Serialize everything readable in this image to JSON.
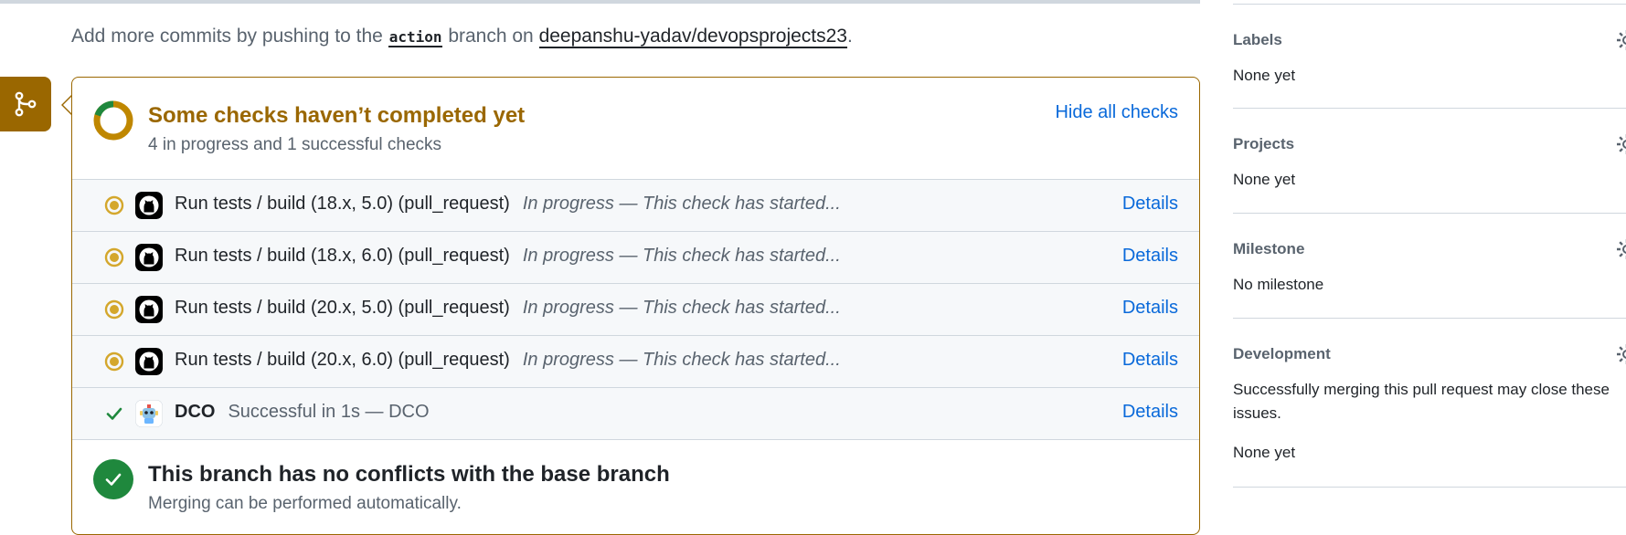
{
  "intro": {
    "prefix": "Add more commits by pushing to the",
    "branch": "action",
    "middle": "branch on",
    "repo": "deepanshu-yadav/devopsprojects23",
    "suffix": "."
  },
  "checks_panel": {
    "title": "Some checks haven’t completed yet",
    "summary": "4 in progress and 1 successful checks",
    "hide_label": "Hide all checks"
  },
  "checks": [
    {
      "name": "Run tests / build (18.x, 5.0) (pull_request)",
      "description": "In progress — This check has started...",
      "details": "Details",
      "status": "in-progress",
      "app_icon": "github-icon"
    },
    {
      "name": "Run tests / build (18.x, 6.0) (pull_request)",
      "description": "In progress — This check has started...",
      "details": "Details",
      "status": "in-progress",
      "app_icon": "github-icon"
    },
    {
      "name": "Run tests / build (20.x, 5.0) (pull_request)",
      "description": "In progress — This check has started...",
      "details": "Details",
      "status": "in-progress",
      "app_icon": "github-icon"
    },
    {
      "name": "Run tests / build (20.x, 6.0) (pull_request)",
      "description": "In progress — This check has started...",
      "details": "Details",
      "status": "in-progress",
      "app_icon": "github-icon"
    },
    {
      "name": "DCO",
      "description": "Successful in 1s — DCO",
      "details": "Details",
      "status": "success",
      "app_icon": "dco-bot-icon"
    }
  ],
  "merge_status": {
    "title": "This branch has no conflicts with the base branch",
    "subtitle": "Merging can be performed automatically."
  },
  "sidebar": {
    "labels": {
      "title": "Labels",
      "value": "None yet"
    },
    "projects": {
      "title": "Projects",
      "value": "None yet"
    },
    "milestone": {
      "title": "Milestone",
      "value": "No milestone"
    },
    "development": {
      "title": "Development",
      "description_line1": "Successfully merging this pull request may close these",
      "description_line2": "issues.",
      "value": "None yet"
    }
  },
  "colors": {
    "pending": "#9a6700",
    "in_progress_dot": "#d4a72c",
    "success": "#1f883d",
    "link": "#0969da",
    "border": "#d0d7de"
  }
}
